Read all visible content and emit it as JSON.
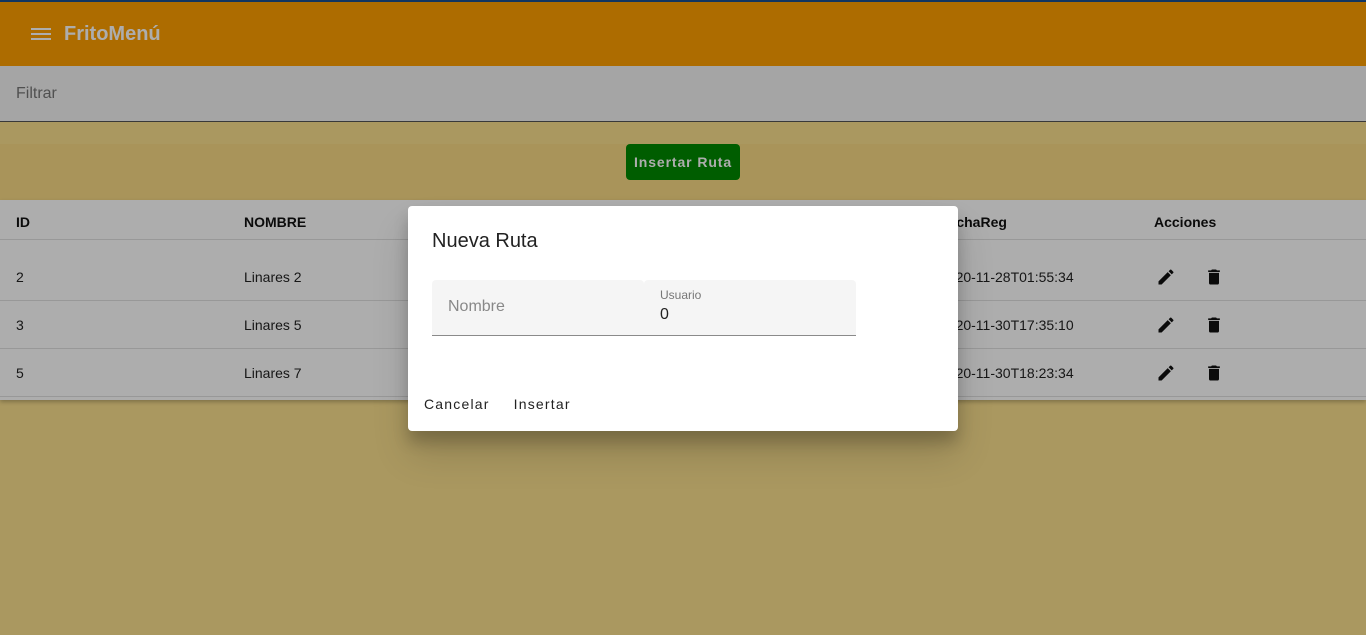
{
  "header": {
    "title": "FritoMenú",
    "menu_icon": "menu-icon",
    "color": "#ffa000"
  },
  "filter": {
    "placeholder": "Filtrar"
  },
  "actions": {
    "insert_label": "Insertar Ruta",
    "insert_color": "#008a00"
  },
  "table": {
    "headers": {
      "id": "ID",
      "nombre": "NOMBRE",
      "fecha": "FechaReg",
      "acciones": "Acciones"
    },
    "rows": [
      {
        "id": "2",
        "nombre": "Linares 2",
        "fecha": "2020-11-28T01:55:34"
      },
      {
        "id": "3",
        "nombre": "Linares 5",
        "fecha": "2020-11-30T17:35:10"
      },
      {
        "id": "5",
        "nombre": "Linares 7",
        "fecha": "2020-11-30T18:23:34"
      }
    ],
    "row_icons": [
      "edit-icon",
      "delete-icon"
    ]
  },
  "dialog": {
    "title": "Nueva Ruta",
    "nombre_placeholder": "Nombre",
    "usuario_label": "Usuario",
    "usuario_value": "0",
    "cancel_label": "Cancelar",
    "insert_label": "Insertar"
  }
}
